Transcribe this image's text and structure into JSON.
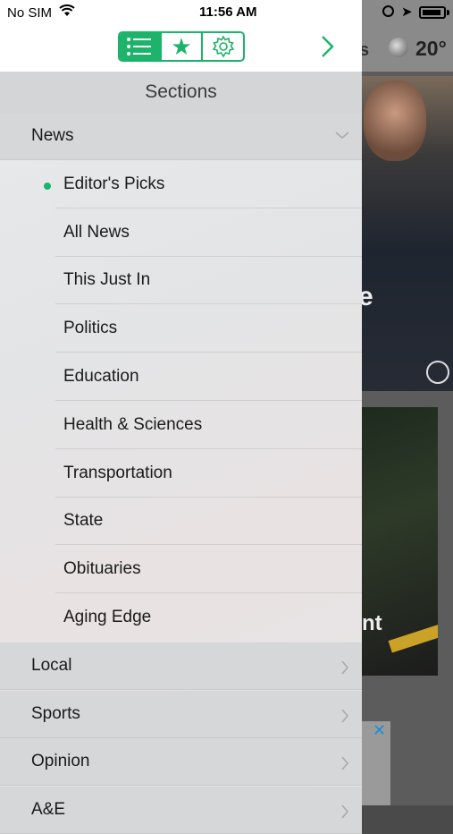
{
  "status_bar": {
    "carrier": "No SIM",
    "time": "11:56 AM"
  },
  "toolbar": {
    "tabs": [
      {
        "icon": "list-icon",
        "active": true
      },
      {
        "icon": "star-icon",
        "active": false
      },
      {
        "icon": "gear-icon",
        "active": false
      }
    ],
    "next_icon": "chevron-right-icon",
    "accent_color": "#1db36a"
  },
  "background": {
    "header_fragment": "s",
    "temperature": "20°",
    "photo1_text": "e",
    "photo2_text": "nt"
  },
  "sections": {
    "title": "Sections",
    "news": {
      "label": "News",
      "expanded": true,
      "items": [
        {
          "label": "Editor's Picks",
          "selected": true
        },
        {
          "label": "All News"
        },
        {
          "label": "This Just In"
        },
        {
          "label": "Politics"
        },
        {
          "label": "Education"
        },
        {
          "label": "Health & Sciences"
        },
        {
          "label": "Transportation"
        },
        {
          "label": "State"
        },
        {
          "label": "Obituaries"
        },
        {
          "label": "Aging Edge"
        }
      ]
    },
    "others": [
      {
        "label": "Local"
      },
      {
        "label": "Sports"
      },
      {
        "label": "Opinion"
      },
      {
        "label": "A&E"
      }
    ]
  }
}
